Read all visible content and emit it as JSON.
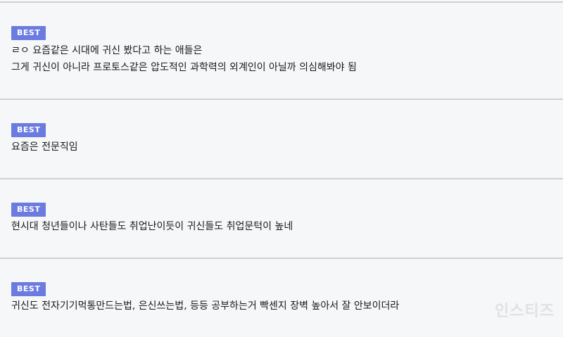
{
  "badge_label": "BEST",
  "comments": [
    {
      "lines": [
        "ㄹㅇ 요즘같은 시대에 귀신 봤다고 하는 애들은",
        "그게 귀신이 아니라 프로토스같은 압도적인 과학력의 외계인이 아닐까 의심해봐야 됨"
      ]
    },
    {
      "lines": [
        "요즘은 전문직임"
      ]
    },
    {
      "lines": [
        "현시대 청년들이나 사탄들도 취업난이듯이 귀신들도 취업문턱이 높네"
      ]
    },
    {
      "lines": [
        "귀신도 전자기기먹통만드는법, 은신쓰는법, 등등 공부하는거 빡센지 장벽 높아서 잘 안보이더라"
      ]
    }
  ],
  "watermark": "인스티즈"
}
